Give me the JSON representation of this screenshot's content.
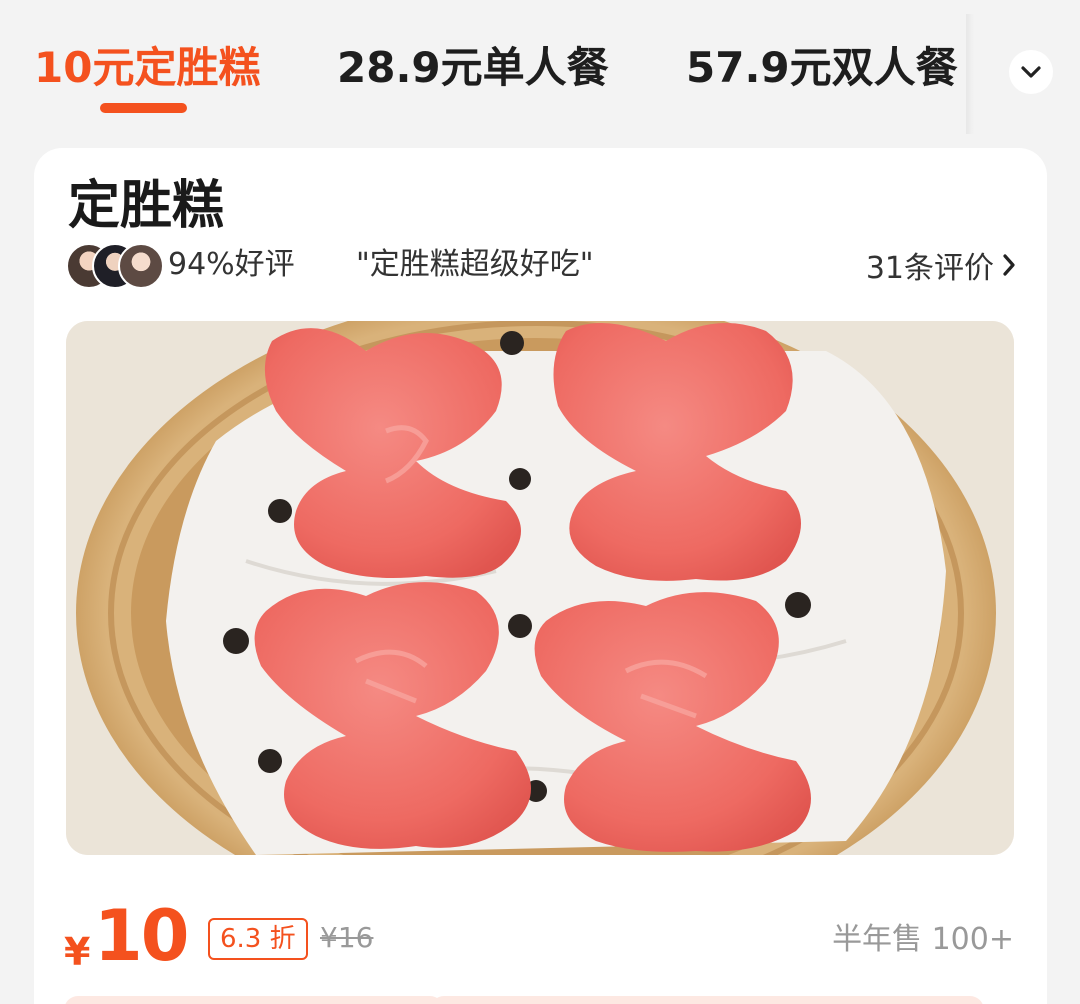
{
  "tabs": [
    {
      "label": "10元定胜糕",
      "active": true
    },
    {
      "label": "28.9元单人餐",
      "active": false
    },
    {
      "label": "57.9元双人餐",
      "active": false
    }
  ],
  "tabs_expand_icon": "chevron-down-icon",
  "product": {
    "title": "定胜糕",
    "rating": "94%好评",
    "review_quote": "\"定胜糕超级好吃\"",
    "review_count": "31条评价",
    "review_link_icon": "chevron-right-icon",
    "currency": "¥",
    "price": "10",
    "discount": "6.3 折",
    "original_price": "¥16",
    "sales": "半年售 100+"
  },
  "colors": {
    "accent": "#f4511e",
    "background": "#f3f3f3",
    "card": "#ffffff",
    "muted_text": "#999999"
  }
}
